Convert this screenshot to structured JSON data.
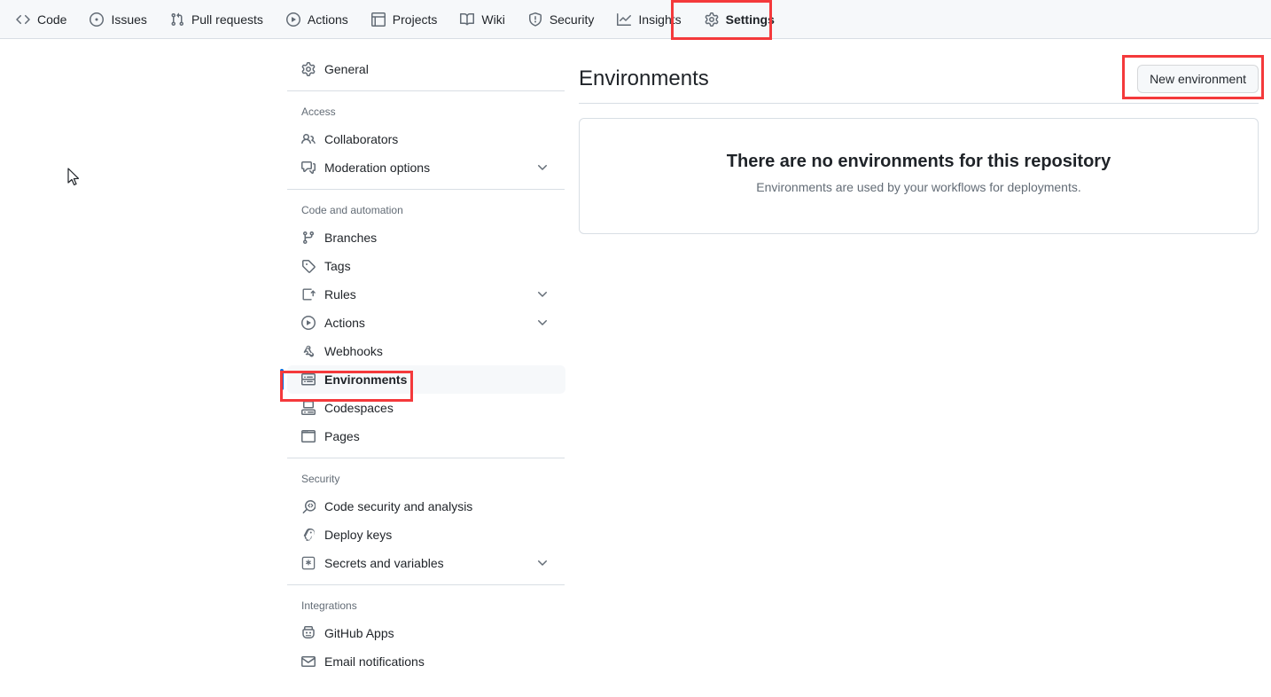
{
  "repo_nav": {
    "tabs": [
      {
        "label": "Code",
        "icon": "code-icon",
        "selected": false
      },
      {
        "label": "Issues",
        "icon": "issue-opened-icon",
        "selected": false
      },
      {
        "label": "Pull requests",
        "icon": "git-pull-request-icon",
        "selected": false
      },
      {
        "label": "Actions",
        "icon": "play-icon",
        "selected": false
      },
      {
        "label": "Projects",
        "icon": "table-icon",
        "selected": false
      },
      {
        "label": "Wiki",
        "icon": "book-icon",
        "selected": false
      },
      {
        "label": "Security",
        "icon": "shield-icon",
        "selected": false
      },
      {
        "label": "Insights",
        "icon": "graph-icon",
        "selected": false
      },
      {
        "label": "Settings",
        "icon": "gear-icon",
        "selected": true
      }
    ]
  },
  "sidebar": {
    "top_items": [
      {
        "label": "General",
        "icon": "gear-icon",
        "chevron": false,
        "active": false
      }
    ],
    "groups": [
      {
        "title": "Access",
        "items": [
          {
            "label": "Collaborators",
            "icon": "people-icon",
            "chevron": false,
            "active": false
          },
          {
            "label": "Moderation options",
            "icon": "comment-discussion-icon",
            "chevron": true,
            "active": false
          }
        ]
      },
      {
        "title": "Code and automation",
        "items": [
          {
            "label": "Branches",
            "icon": "git-branch-icon",
            "chevron": false,
            "active": false
          },
          {
            "label": "Tags",
            "icon": "tag-icon",
            "chevron": false,
            "active": false
          },
          {
            "label": "Rules",
            "icon": "rules-icon",
            "chevron": true,
            "active": false
          },
          {
            "label": "Actions",
            "icon": "play-icon",
            "chevron": true,
            "active": false
          },
          {
            "label": "Webhooks",
            "icon": "webhook-icon",
            "chevron": false,
            "active": false
          },
          {
            "label": "Environments",
            "icon": "server-icon",
            "chevron": false,
            "active": true
          },
          {
            "label": "Codespaces",
            "icon": "codespaces-icon",
            "chevron": false,
            "active": false
          },
          {
            "label": "Pages",
            "icon": "browser-icon",
            "chevron": false,
            "active": false
          }
        ]
      },
      {
        "title": "Security",
        "items": [
          {
            "label": "Code security and analysis",
            "icon": "codescan-icon",
            "chevron": false,
            "active": false
          },
          {
            "label": "Deploy keys",
            "icon": "key-icon",
            "chevron": false,
            "active": false
          },
          {
            "label": "Secrets and variables",
            "icon": "asterisk-box-icon",
            "chevron": true,
            "active": false
          }
        ]
      },
      {
        "title": "Integrations",
        "items": [
          {
            "label": "GitHub Apps",
            "icon": "apps-icon",
            "chevron": false,
            "active": false
          },
          {
            "label": "Email notifications",
            "icon": "mail-icon",
            "chevron": false,
            "active": false
          }
        ]
      }
    ]
  },
  "main": {
    "title": "Environments",
    "new_environment_button": "New environment",
    "empty_state": {
      "heading": "There are no environments for this repository",
      "description": "Environments are used by your workflows for deployments."
    }
  },
  "colors": {
    "annotation": "#f4393b",
    "accent": "#0969da",
    "nav_bg": "#f6f8fa",
    "border": "#d8dee4",
    "text": "#1f2328",
    "muted": "#636c76"
  }
}
